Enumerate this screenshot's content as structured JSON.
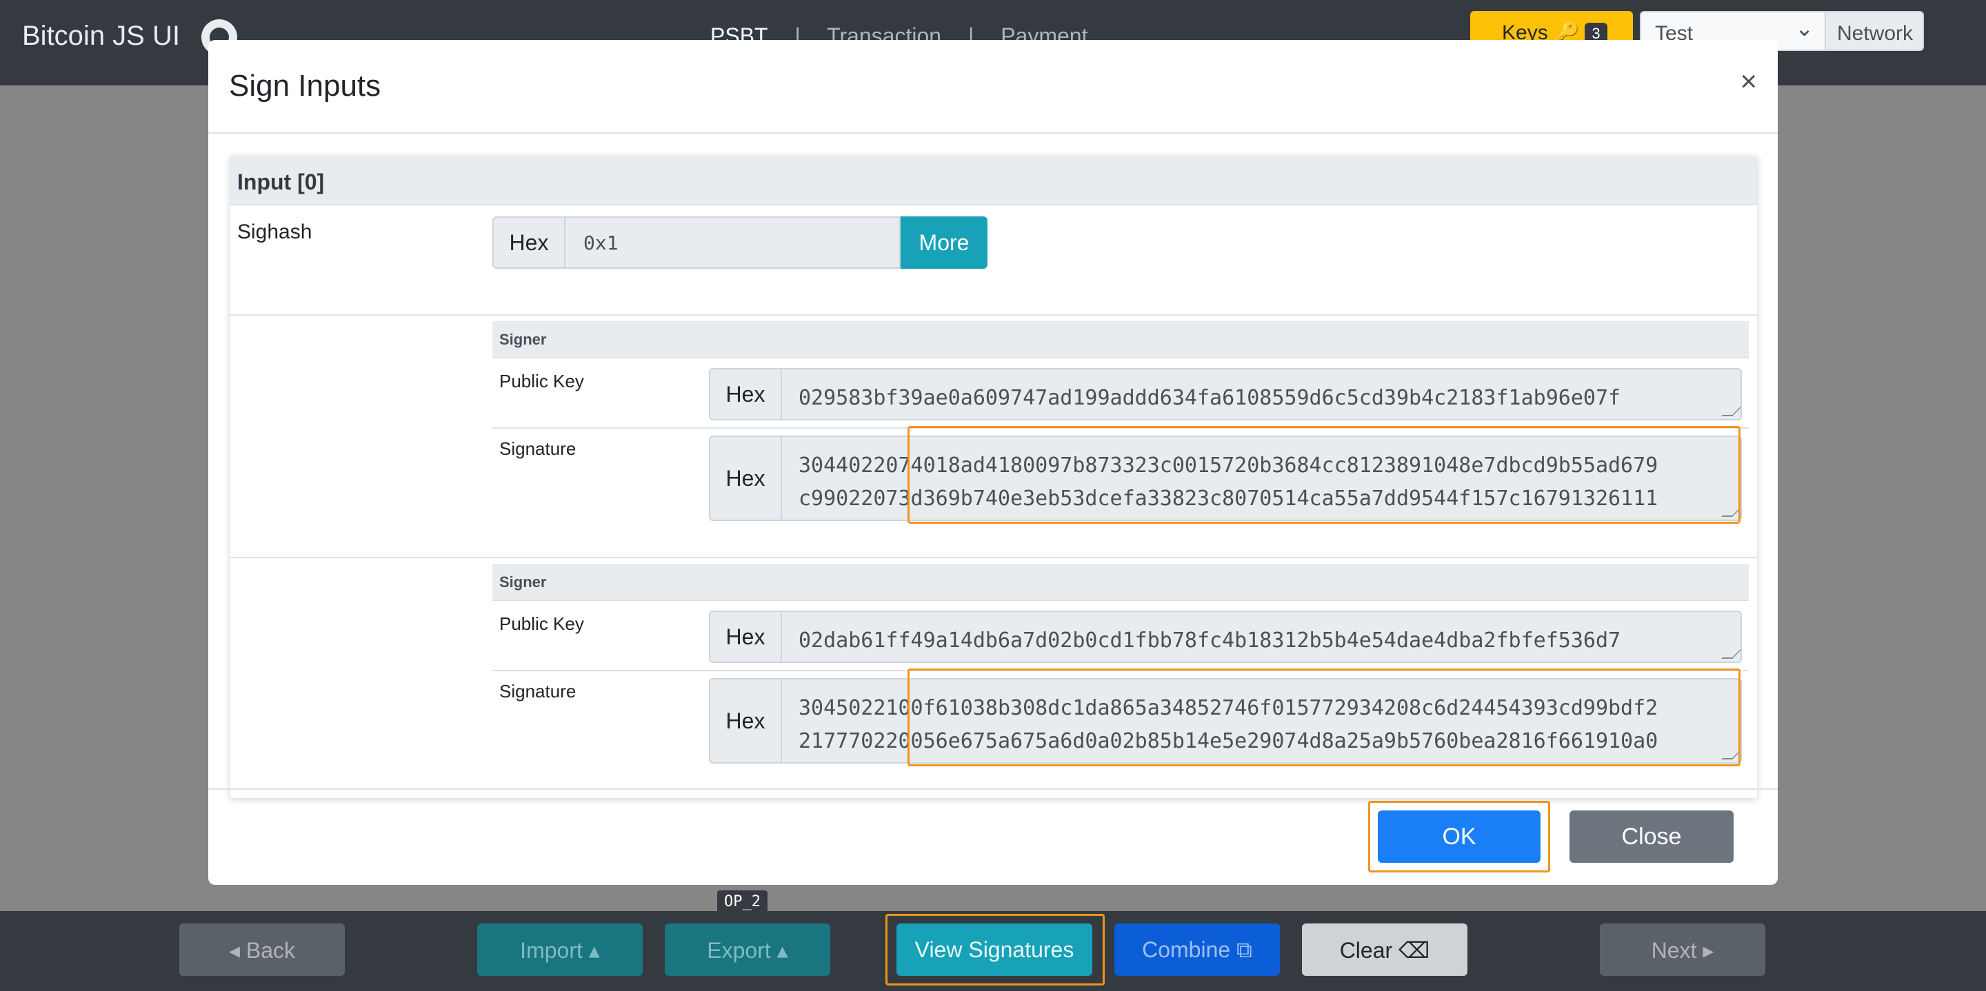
{
  "navbar": {
    "brand": "Bitcoin JS UI",
    "links": [
      "PSBT",
      "|",
      "Transaction",
      "|",
      "Payment"
    ],
    "keys_label": "Keys 🔑",
    "keys_count": "3",
    "network_value": "Test",
    "network_label": "Network"
  },
  "modal": {
    "title": "Sign Inputs",
    "close_symbol": "×",
    "input_header": "Input [0]",
    "sighash": {
      "label": "Sighash",
      "prefix": "Hex",
      "value": "0x1",
      "more_label": "More"
    },
    "signers": [
      {
        "header": "Signer",
        "public_key_label": "Public Key",
        "public_key_prefix": "Hex",
        "public_key": "029583bf39ae0a609747ad199addd634fa6108559d6c5cd39b4c2183f1ab96e07f",
        "signature_label": "Signature",
        "signature_prefix": "Hex",
        "signature": "3044022074018ad4180097b873323c0015720b3684cc8123891048e7dbcd9b55ad679\nc99022073d369b740e3eb53dcefa33823c8070514ca55a7dd9544f157c16791326111"
      },
      {
        "header": "Signer",
        "public_key_label": "Public Key",
        "public_key_prefix": "Hex",
        "public_key": "02dab61ff49a14db6a7d02b0cd1fbb78fc4b18312b5b4e54dae4dba2fbfef536d7",
        "signature_label": "Signature",
        "signature_prefix": "Hex",
        "signature": "3045022100f61038b308dc1da865a34852746f015772934208c6d24454393cd99bdf2\n217770220056e675a675a6d0a02b85b14e5e29074d8a25a9b5760bea2816f661910a0"
      }
    ],
    "ok_label": "OK",
    "close_label": "Close"
  },
  "background": {
    "op_chip": "OP_2"
  },
  "toolbar": {
    "back": "◂  Back",
    "import": "Import  ▴",
    "export": "Export  ▴",
    "view_signatures": "View Signatures",
    "combine": "Combine ⧉",
    "clear": "Clear ⌫",
    "next": "Next  ▸"
  },
  "colors": {
    "navbar": "#343a40",
    "accent_info": "#17a2b8",
    "primary": "#1a7ff7",
    "secondary": "#6c757d",
    "warning": "#ffc107",
    "focus": "#f0941e"
  }
}
